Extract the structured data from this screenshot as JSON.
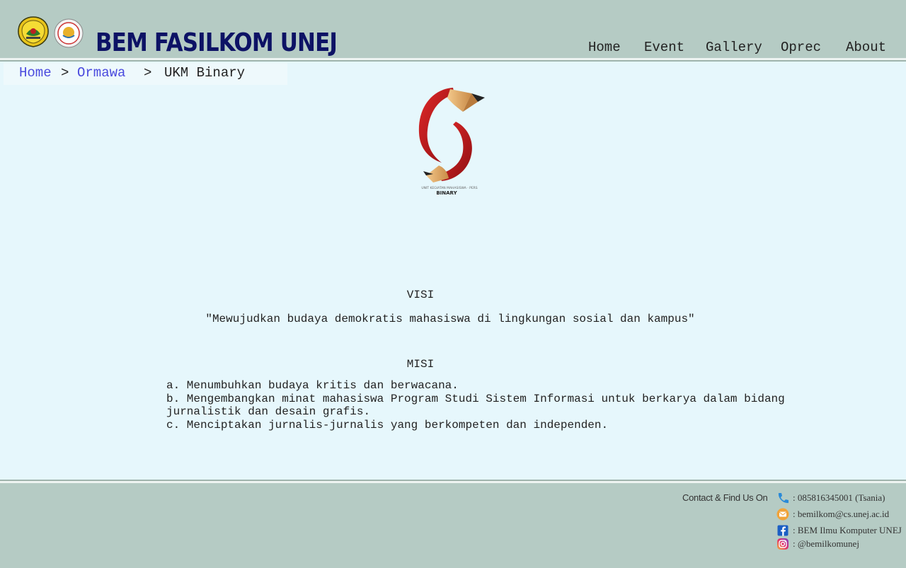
{
  "header": {
    "brand": "BEM FASILKOM UNEJ",
    "nav": [
      {
        "label": "Home"
      },
      {
        "label": "Event"
      },
      {
        "label": "Gallery"
      },
      {
        "label": "Oprec"
      },
      {
        "label": "About"
      }
    ]
  },
  "breadcrumb": {
    "items": [
      {
        "label": "Home"
      },
      {
        "label": "Ormawa"
      },
      {
        "label": "UKM Binary"
      }
    ],
    "separator": ">"
  },
  "ukm_logo": {
    "caption_small": "UNIT KEGIATAN MAHASISWA · PERS",
    "caption": "BINARY"
  },
  "visi": {
    "title": "VISI",
    "text": "\"Mewujudkan budaya demokratis mahasiswa di lingkungan sosial dan kampus\""
  },
  "misi": {
    "title": "MISI",
    "items": [
      "a. Menumbuhkan budaya kritis dan berwacana.",
      "b. Mengembangkan minat mahasiswa Program Studi Sistem Informasi untuk berkarya dalam bidang jurnalistik dan desain grafis.",
      "c. Menciptakan jurnalis-jurnalis yang berkompeten dan independen."
    ]
  },
  "footer": {
    "label": "Contact & Find Us On",
    "contacts": [
      {
        "icon": "phone-icon",
        "text": ": 085816345001 (Tsania)"
      },
      {
        "icon": "email-icon",
        "text": ": bemilkom@cs.unej.ac.id"
      },
      {
        "icon": "facebook-icon",
        "text": ": BEM Ilmu Komputer UNEJ"
      },
      {
        "icon": "instagram-icon",
        "text": ": @bemilkomunej"
      }
    ]
  },
  "colors": {
    "header_bg": "#b5cbc4",
    "page_bg": "#e6f7fc",
    "brand": "#0d1265",
    "link": "#4a4ade"
  }
}
